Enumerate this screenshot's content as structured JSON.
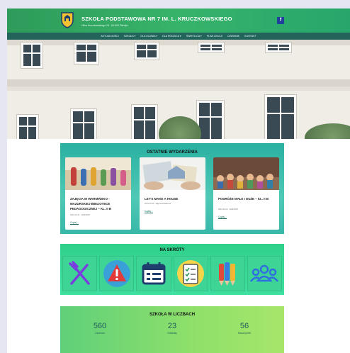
{
  "header": {
    "school_name": "SZKOŁA PODSTAWOWA NR 7 IM. L. KRUCZKOWSKIEGO",
    "address": "Ulica Kruczkowskiego 15 · 00-000 Olsztyn",
    "facebook_icon": "facebook-icon"
  },
  "nav": {
    "items": [
      {
        "label": "Aktualności"
      },
      {
        "label": "Szkoła ▾"
      },
      {
        "label": "Dla ucznia ▾"
      },
      {
        "label": "Dla rodzica ▾"
      },
      {
        "label": "Świetlica ▾"
      },
      {
        "label": "Plan lekcji"
      },
      {
        "label": "Dziennik"
      },
      {
        "label": "Kontakt"
      }
    ]
  },
  "events": {
    "title": "OSTATNIE WYDARZENIA",
    "cards": [
      {
        "title": "ZAJĘCIA W WARMIŃSKO - MAZURSKIEJ BIBLIOTECE PEDAGOGICZNEJ – KL. II B",
        "meta": "2024-10-31 · 2024/2025",
        "more": "Czytaj..."
      },
      {
        "title": "LET'S MAKE A HOUSE",
        "meta": "2024-10-30 · Zajęcia dodatkowe",
        "more": "Czytaj..."
      },
      {
        "title": "PODRÓŻE MAŁE I DUŻE – KL. II B",
        "meta": "2024-10-29 · 2024/2025",
        "more": "Czytaj..."
      }
    ]
  },
  "shortcuts": {
    "title": "NA SKRÓTY",
    "icons": [
      "cutlery-icon",
      "warning-icon",
      "calendar-icon",
      "checklist-icon",
      "pencils-icon",
      "people-icon"
    ]
  },
  "stats": {
    "title": "SZKOŁA W LICZBACH",
    "items": [
      {
        "value": "560",
        "label": "Uczniów"
      },
      {
        "value": "23",
        "label": "Oddziały"
      },
      {
        "value": "56",
        "label": "Nauczycieli"
      }
    ]
  },
  "colors": {
    "header_green": "#37b36a",
    "nav_teal": "#23645a",
    "events_teal": "#29b0a1",
    "shortcuts_green": "#3ed496",
    "stats_green": "#8fe06a"
  }
}
